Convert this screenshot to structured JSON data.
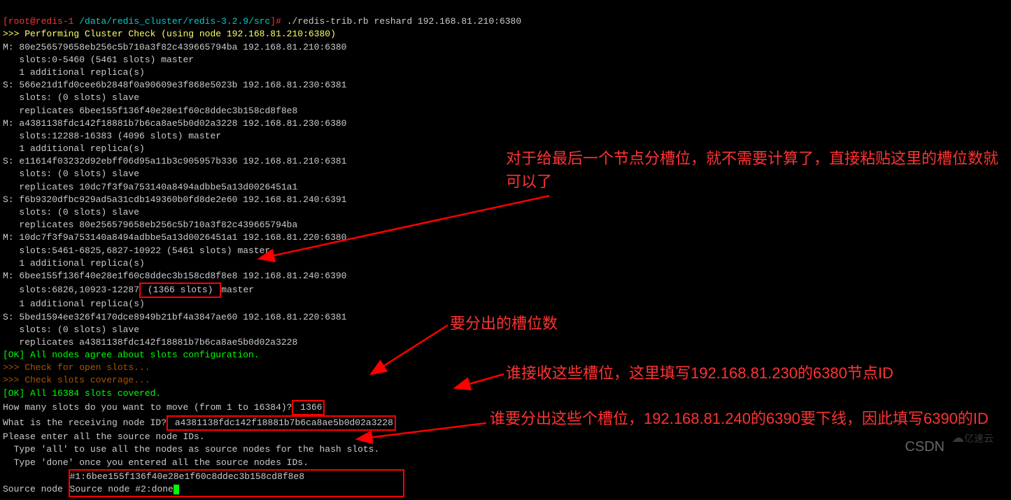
{
  "prompt": {
    "user_host": "[root@redis-1",
    "path": " /data/redis_cluster/redis-3.2.9/src",
    "end": "]#",
    "command": " ./redis-trib.rb reshard 192.168.81.210:6380"
  },
  "lines": {
    "l1": ">>> Performing Cluster Check (using node 192.168.81.210:6380)",
    "l2": "M: 80e256579658eb256c5b710a3f82c439665794ba 192.168.81.210:6380",
    "l3": "   slots:0-5460 (5461 slots) master",
    "l4": "   1 additional replica(s)",
    "l5": "S: 566e21d1fd0cee6b2848f0a90609e3f868e5023b 192.168.81.230:6381",
    "l6": "   slots: (0 slots) slave",
    "l7": "   replicates 6bee155f136f40e28e1f60c8ddec3b158cd8f8e8",
    "l8": "M: a4381138fdc142f18881b7b6ca8ae5b0d02a3228 192.168.81.230:6380",
    "l9": "   slots:12288-16383 (4096 slots) master",
    "l10": "   1 additional replica(s)",
    "l11": "S: e11614f03232d92ebff06d95a11b3c905957b336 192.168.81.210:6381",
    "l12": "   slots: (0 slots) slave",
    "l13": "   replicates 10dc7f3f9a753140a8494adbbe5a13d0026451a1",
    "l14": "S: f6b9320dfbc929ad5a31cdb149360b0fd8de2e60 192.168.81.240:6391",
    "l15": "   slots: (0 slots) slave",
    "l16": "   replicates 80e256579658eb256c5b710a3f82c439665794ba",
    "l17": "M: 10dc7f3f9a753140a8494adbbe5a13d0026451a1 192.168.81.220:6380",
    "l18": "   slots:5461-6825,6827-10922 (5461 slots) master",
    "l19": "   1 additional replica(s)",
    "l20a": "M: 6bee155f136f40e28e1f60c8ddec3b158cd8f8e8 192.168.81.240:6390",
    "l21a": "   slots:6826,10923-12287",
    "l21b": " (1366 slots) ",
    "l21c": "master",
    "l22": "   1 additional replica(s)",
    "l23": "S: 5bed1594ee326f4170dce8949b21bf4a3847ae60 192.168.81.220:6381",
    "l24": "   slots: (0 slots) slave",
    "l25": "   replicates a4381138fdc142f18881b7b6ca8ae5b0d02a3228",
    "l26": "[OK] All nodes agree about slots configuration.",
    "l27": ">>> Check for open slots...",
    "l28": ">>> Check slots coverage...",
    "l29": "[OK] All 16384 slots covered.",
    "l30a": "How many slots do you want to move (from 1 to 16384)?",
    "l30b": " 1366",
    "l31a": "What is the receiving node ID?",
    "l31b": " a4381138fdc142f18881b7b6ca8ae5b0d02a3228",
    "l32": "Please enter all the source node IDs.",
    "l33": "  Type 'all' to use all the nodes as source nodes for the hash slots.",
    "l34": "  Type 'done' once you entered all the source nodes IDs.",
    "l35a": "Source node ",
    "l35b": "#1:6bee155f136f40e28e1f60c8ddec3b158cd8f8e8",
    "l36a": "Source node ",
    "l36b": "#2:done"
  },
  "annotations": {
    "a1": "对于给最后一个节点分槽位，就不需要计算了，直接粘贴这里的槽位数就可以了",
    "a2": "要分出的槽位数",
    "a3": "谁接收这些槽位，这里填写192.168.81.230的6380节点ID",
    "a4": "谁要分出这些个槽位，192.168.81.240的6390要下线，因此填写6390的ID"
  },
  "footer": {
    "csdn": "CSDN",
    "logo": "亿速云"
  }
}
